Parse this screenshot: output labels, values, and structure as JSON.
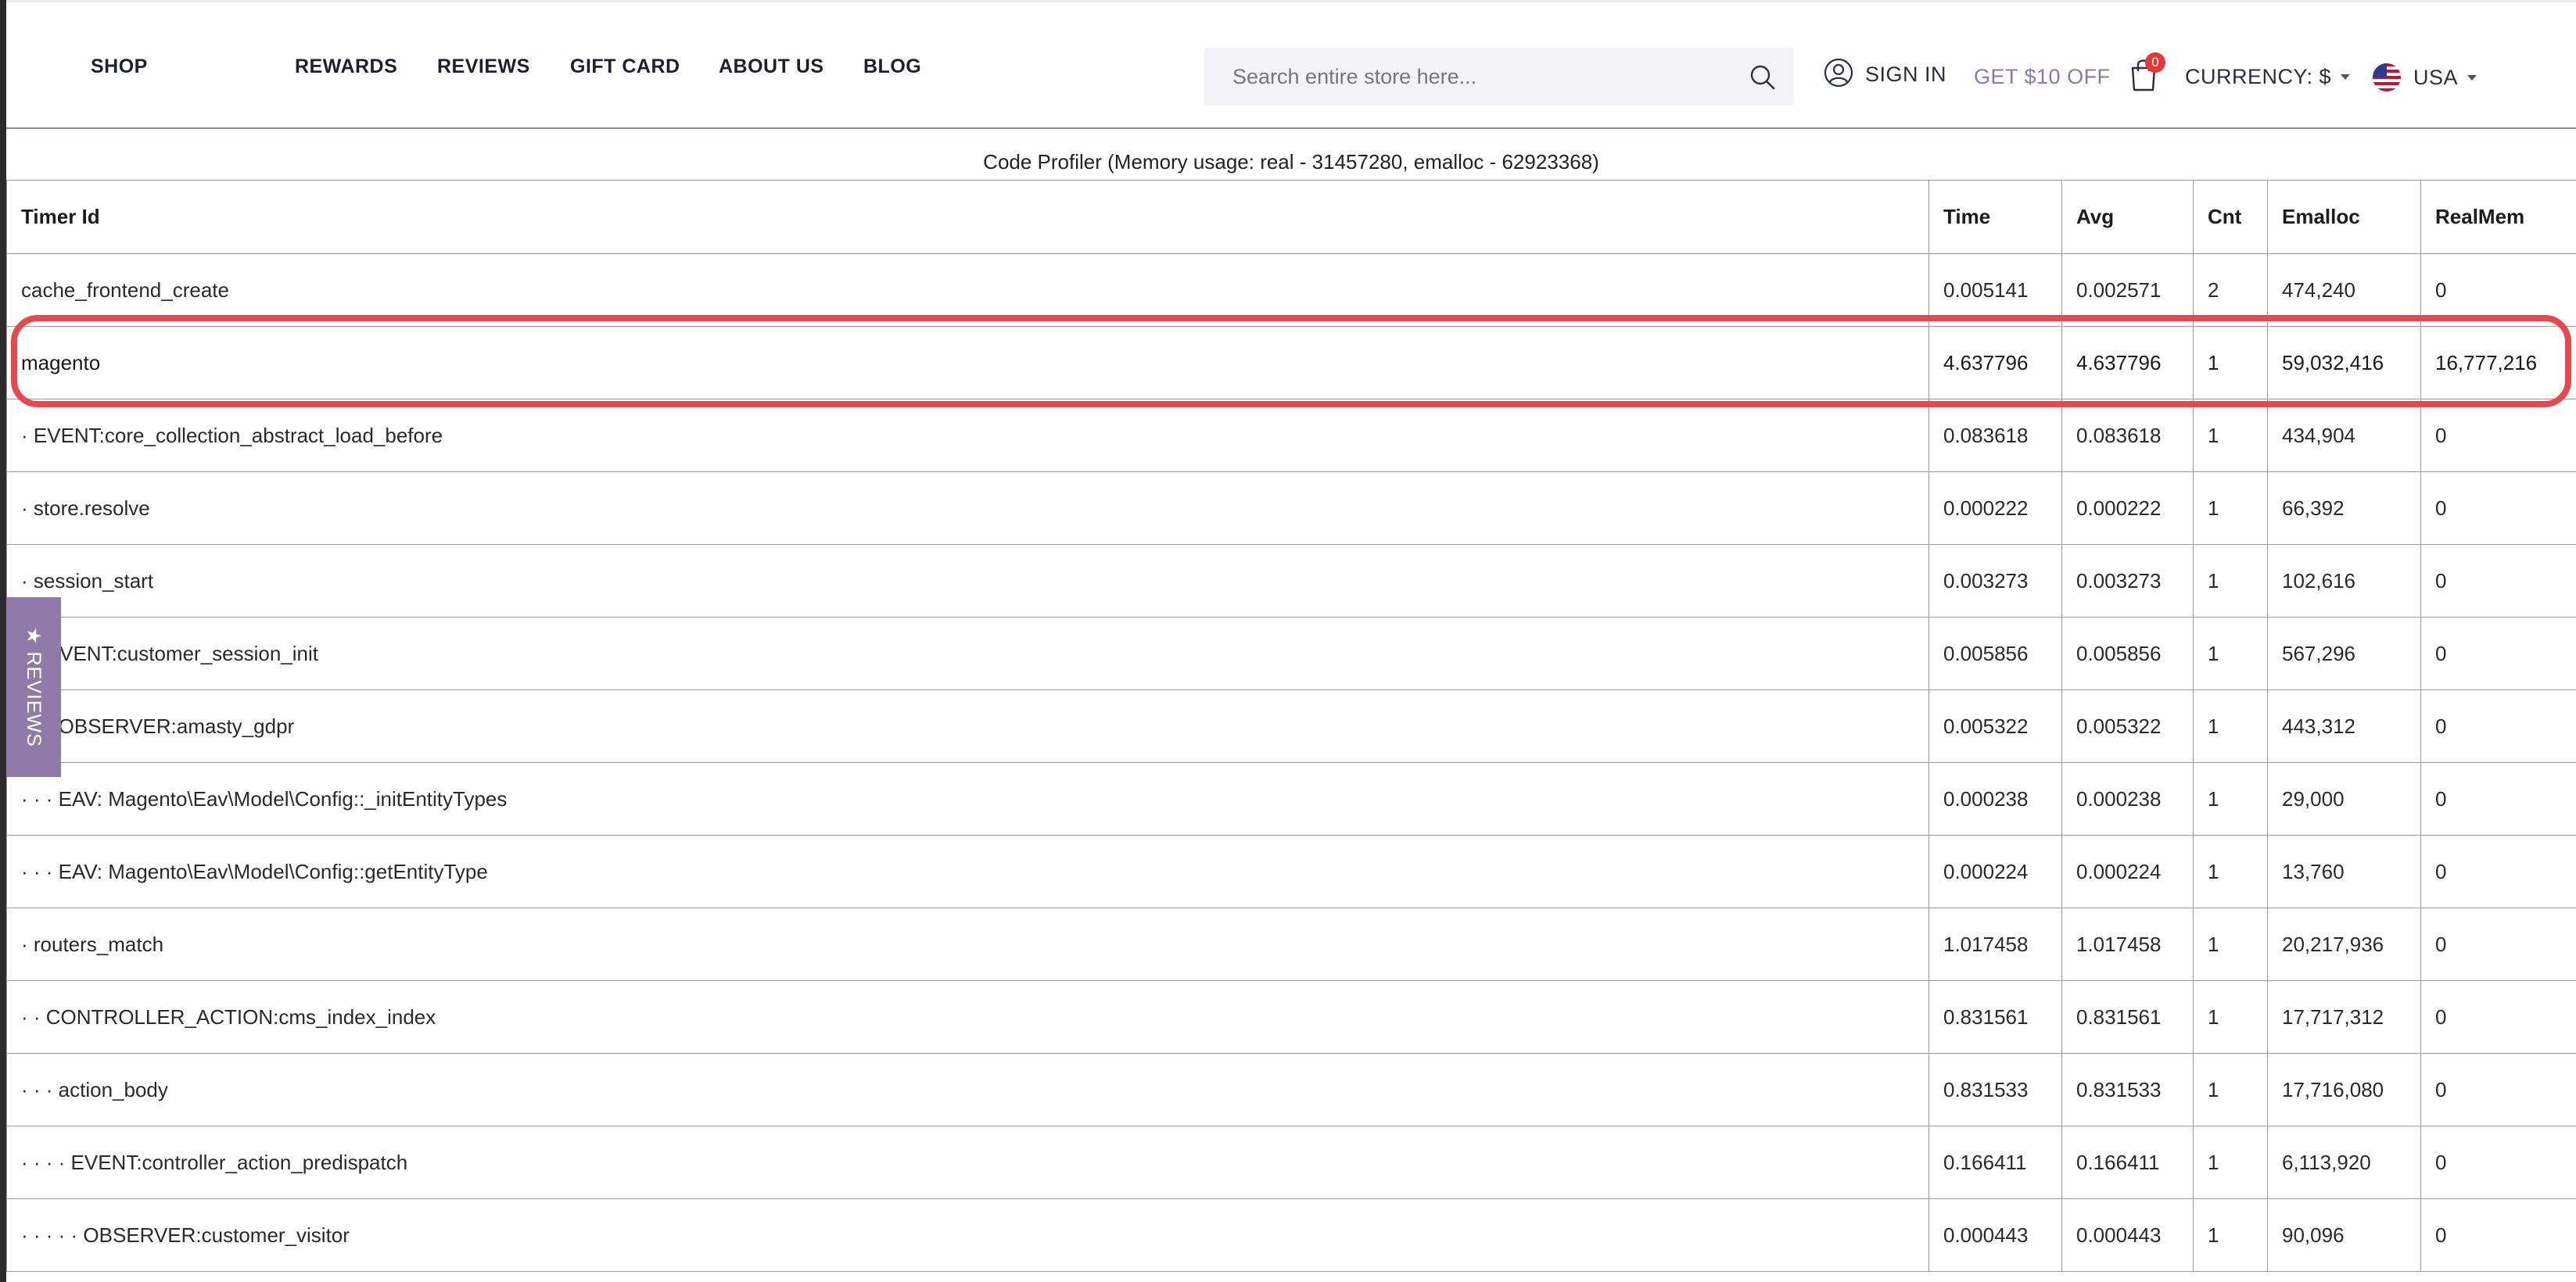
{
  "nav": {
    "shop": "SHOP",
    "rewards": "REWARDS",
    "reviews": "REVIEWS",
    "gift_card": "GIFT CARD",
    "about_us": "ABOUT US",
    "blog": "BLOG"
  },
  "search": {
    "placeholder": "Search entire store here...",
    "value": "",
    "icon": "search-icon"
  },
  "account": {
    "sign_in": "SIGN IN",
    "icon": "user-icon",
    "promo": "GET $10 OFF"
  },
  "cart": {
    "count": "0",
    "icon": "cart-icon",
    "badge_color": "#e53935"
  },
  "currency": {
    "label": "CURRENCY: $"
  },
  "country": {
    "label": "USA",
    "icon": "us-flag-icon"
  },
  "profiler": {
    "caption": "Code Profiler (Memory usage: real - 31457280, emalloc - 62923368)",
    "columns": [
      "Timer Id",
      "Time",
      "Avg",
      "Cnt",
      "Emalloc",
      "RealMem"
    ],
    "rows": [
      [
        "cache_frontend_create",
        "0.005141",
        "0.002571",
        "2",
        "474,240",
        "0"
      ],
      [
        "magento",
        "4.637796",
        "4.637796",
        "1",
        "59,032,416",
        "16,777,216"
      ],
      [
        "· EVENT:core_collection_abstract_load_before",
        "0.083618",
        "0.083618",
        "1",
        "434,904",
        "0"
      ],
      [
        "· store.resolve",
        "0.000222",
        "0.000222",
        "1",
        "66,392",
        "0"
      ],
      [
        "· session_start",
        "0.003273",
        "0.003273",
        "1",
        "102,616",
        "0"
      ],
      [
        "· · EVENT:customer_session_init",
        "0.005856",
        "0.005856",
        "1",
        "567,296",
        "0"
      ],
      [
        "· · · OBSERVER:amasty_gdpr",
        "0.005322",
        "0.005322",
        "1",
        "443,312",
        "0"
      ],
      [
        "· · · EAV: Magento\\Eav\\Model\\Config::_initEntityTypes",
        "0.000238",
        "0.000238",
        "1",
        "29,000",
        "0"
      ],
      [
        "· · · EAV: Magento\\Eav\\Model\\Config::getEntityType",
        "0.000224",
        "0.000224",
        "1",
        "13,760",
        "0"
      ],
      [
        "· routers_match",
        "1.017458",
        "1.017458",
        "1",
        "20,217,936",
        "0"
      ],
      [
        "· · CONTROLLER_ACTION:cms_index_index",
        "0.831561",
        "0.831561",
        "1",
        "17,717,312",
        "0"
      ],
      [
        "· · · action_body",
        "0.831533",
        "0.831533",
        "1",
        "17,716,080",
        "0"
      ],
      [
        "· · · · EVENT:controller_action_predispatch",
        "0.166411",
        "0.166411",
        "1",
        "6,113,920",
        "0"
      ],
      [
        "· · · · · OBSERVER:customer_visitor",
        "0.000443",
        "0.000443",
        "1",
        "90,096",
        "0"
      ]
    ],
    "highlight_row": 1,
    "highlight_color": "#e8474d"
  },
  "side_tab": {
    "label": "★ REVIEWS",
    "color": "#8f7aa8"
  },
  "colors": {
    "accent": "#8a7aa6",
    "header_rule": "#8c8aa8"
  }
}
